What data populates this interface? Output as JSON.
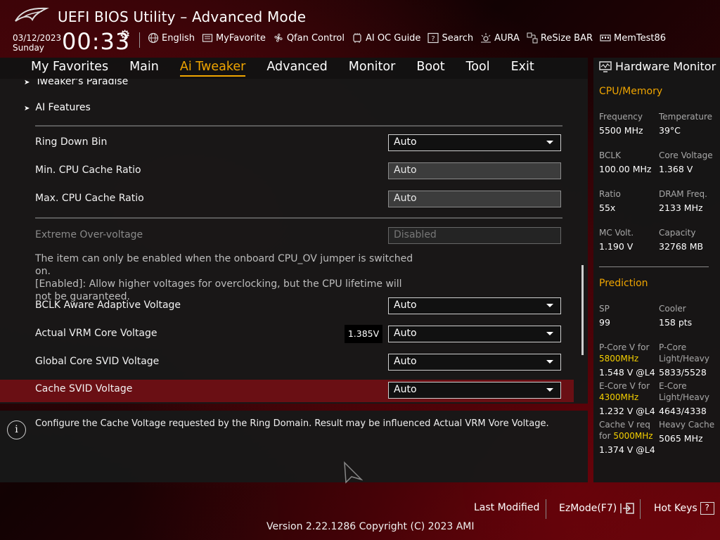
{
  "header": {
    "title": "UEFI BIOS Utility – Advanced Mode",
    "date": "03/12/2023",
    "day": "Sunday",
    "time": "00:33",
    "tools": [
      {
        "icon": "globe-icon",
        "label": "English"
      },
      {
        "icon": "favorite-icon",
        "label": "MyFavorite"
      },
      {
        "icon": "fan-icon",
        "label": "Qfan Control"
      },
      {
        "icon": "ai-chip-icon",
        "label": "AI OC Guide"
      },
      {
        "icon": "search-icon",
        "label": "Search"
      },
      {
        "icon": "aura-icon",
        "label": "AURA"
      },
      {
        "icon": "resize-bar-icon",
        "label": "ReSize BAR"
      },
      {
        "icon": "memtest-icon",
        "label": "MemTest86"
      }
    ]
  },
  "nav": {
    "tabs": [
      "My Favorites",
      "Main",
      "Ai Tweaker",
      "Advanced",
      "Monitor",
      "Boot",
      "Tool",
      "Exit"
    ],
    "active": "Ai Tweaker"
  },
  "settings": {
    "tweakers_paradise": "Tweaker's Paradise",
    "ai_features": "AI Features",
    "ring_down_bin": {
      "label": "Ring Down Bin",
      "value": "Auto"
    },
    "min_cache_ratio": {
      "label": "Min. CPU Cache Ratio",
      "value": "Auto"
    },
    "max_cache_ratio": {
      "label": "Max. CPU Cache Ratio",
      "value": "Auto"
    },
    "extreme_overvoltage": {
      "label": "Extreme Over-voltage",
      "value": "Disabled"
    },
    "extreme_desc_1": "The item can only be enabled when the onboard CPU_OV jumper is switched on.",
    "extreme_desc_2": "[Enabled]: Allow higher voltages for overclocking, but the CPU lifetime will not be guaranteed.",
    "bclk_aware": {
      "label": "BCLK Aware Adaptive Voltage",
      "value": "Auto"
    },
    "actual_vrm": {
      "label": "Actual VRM Core Voltage",
      "value": "Auto",
      "reading": "1.385V"
    },
    "global_svid": {
      "label": "Global Core SVID Voltage",
      "value": "Auto"
    },
    "cache_svid": {
      "label": "Cache SVID Voltage",
      "value": "Auto"
    }
  },
  "help": {
    "text": "Configure the Cache Voltage requested by the Ring Domain. Result may be influenced Actual VRM Vore Voltage."
  },
  "hardware_monitor": {
    "title": "Hardware Monitor",
    "cpu_memory": {
      "section": "CPU/Memory",
      "frequency_label": "Frequency",
      "frequency": "5500 MHz",
      "temperature_label": "Temperature",
      "temperature": "39°C",
      "bclk_label": "BCLK",
      "bclk": "100.00 MHz",
      "core_voltage_label": "Core Voltage",
      "core_voltage": "1.368 V",
      "ratio_label": "Ratio",
      "ratio": "55x",
      "dram_freq_label": "DRAM Freq.",
      "dram_freq": "2133 MHz",
      "mc_volt_label": "MC Volt.",
      "mc_volt": "1.190 V",
      "capacity_label": "Capacity",
      "capacity": "32768 MB"
    },
    "prediction": {
      "section": "Prediction",
      "sp_label": "SP",
      "sp": "99",
      "cooler_label": "Cooler",
      "cooler": "158 pts",
      "pcore_v_label": "P-Core V for",
      "pcore_v_freq": "5800MHz",
      "pcore_v": "1.548 V @L4",
      "pcore_lh_label_1": "P-Core",
      "pcore_lh_label_2": "Light/Heavy",
      "pcore_lh": "5833/5528",
      "ecore_v_label": "E-Core V for",
      "ecore_v_freq": "4300MHz",
      "ecore_v": "1.232 V @L4",
      "ecore_lh_label_1": "E-Core",
      "ecore_lh_label_2": "Light/Heavy",
      "ecore_lh": "4643/4338",
      "cache_v_label_1": "Cache V req",
      "cache_v_label_2": "for",
      "cache_v_freq": "5000MHz",
      "cache_v": "1.374 V @L4",
      "heavy_cache_label": "Heavy Cache",
      "heavy_cache": "5065 MHz"
    }
  },
  "footer": {
    "last_modified": "Last Modified",
    "ezmode": "EzMode(F7)",
    "hot_keys": "Hot Keys",
    "hot_keys_icon_text": "?",
    "version": "Version 2.22.1286 Copyright (C) 2023 AMI"
  },
  "colors": {
    "accent": "#f0a500",
    "selected_row": "#6a0f14",
    "highlight_text": "#f5d000"
  }
}
